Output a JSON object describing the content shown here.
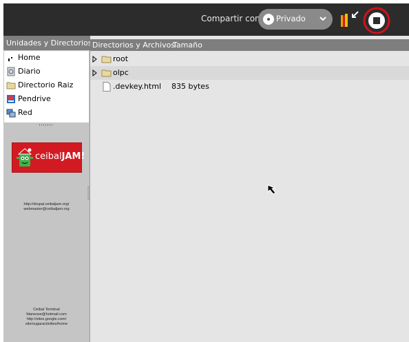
{
  "toolbar": {
    "share_label": "Compartir con:",
    "share_value": "Privado"
  },
  "left_pane": {
    "header": "Unidades y Directorios",
    "items": [
      {
        "label": "Home",
        "icon": "home-icon"
      },
      {
        "label": "Diario",
        "icon": "journal-icon"
      },
      {
        "label": "Directorio Raiz",
        "icon": "folder-icon"
      },
      {
        "label": "Pendrive",
        "icon": "usb-drive-icon"
      },
      {
        "label": "Red",
        "icon": "network-icon"
      }
    ],
    "logo_text": "ceibal",
    "logo_text_bold": "JAM!",
    "contact1": [
      "http://drupal.ceibaljam.org/",
      "webmaster@ceibaljam.org"
    ],
    "contact2": [
      "Ceibal Terminal",
      "fdanesse@hotmail.com",
      "http://sites.google.com/",
      "site/sugaractivities/home"
    ]
  },
  "right_pane": {
    "col_name": "Directorios y Archivos",
    "col_size": "Tamaño",
    "rows": [
      {
        "name": "root",
        "size": "",
        "type": "folder",
        "expandable": true
      },
      {
        "name": "olpc",
        "size": "",
        "type": "folder",
        "expandable": true
      },
      {
        "name": ".devkey.html",
        "size": "835 bytes",
        "type": "file",
        "expandable": false
      }
    ]
  },
  "colors": {
    "toolbar_bg": "#2c2c2c",
    "stop_ring": "#d0121b",
    "logo_red": "#d21a22",
    "logo_green": "#3cb54a"
  }
}
